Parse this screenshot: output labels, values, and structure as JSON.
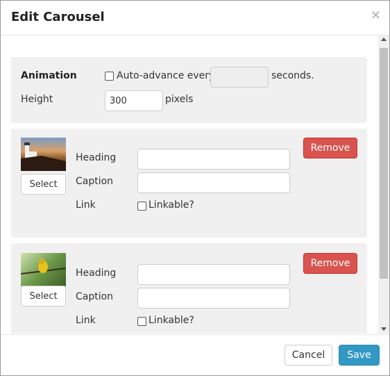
{
  "dialog": {
    "title": "Edit Carousel",
    "close": "×"
  },
  "settings": {
    "animation_label": "Animation",
    "auto_advance_label": "Auto-advance every",
    "auto_advance_value": "",
    "seconds_label": "seconds.",
    "height_label": "Height",
    "height_value": "300",
    "pixels_label": "pixels"
  },
  "slides": [
    {
      "image": "lighthouse",
      "select_label": "Select",
      "heading_label": "Heading",
      "heading_value": "",
      "caption_label": "Caption",
      "caption_value": "",
      "link_label": "Link",
      "linkable_label": "Linkable?",
      "remove_label": "Remove"
    },
    {
      "image": "bird",
      "select_label": "Select",
      "heading_label": "Heading",
      "heading_value": "",
      "caption_label": "Caption",
      "caption_value": "",
      "link_label": "Link",
      "linkable_label": "Linkable?",
      "remove_label": "Remove"
    }
  ],
  "footer": {
    "cancel_label": "Cancel",
    "save_label": "Save"
  },
  "colors": {
    "remove": "#d9534f",
    "save": "#3399c4",
    "panel": "#f0f0f0"
  }
}
